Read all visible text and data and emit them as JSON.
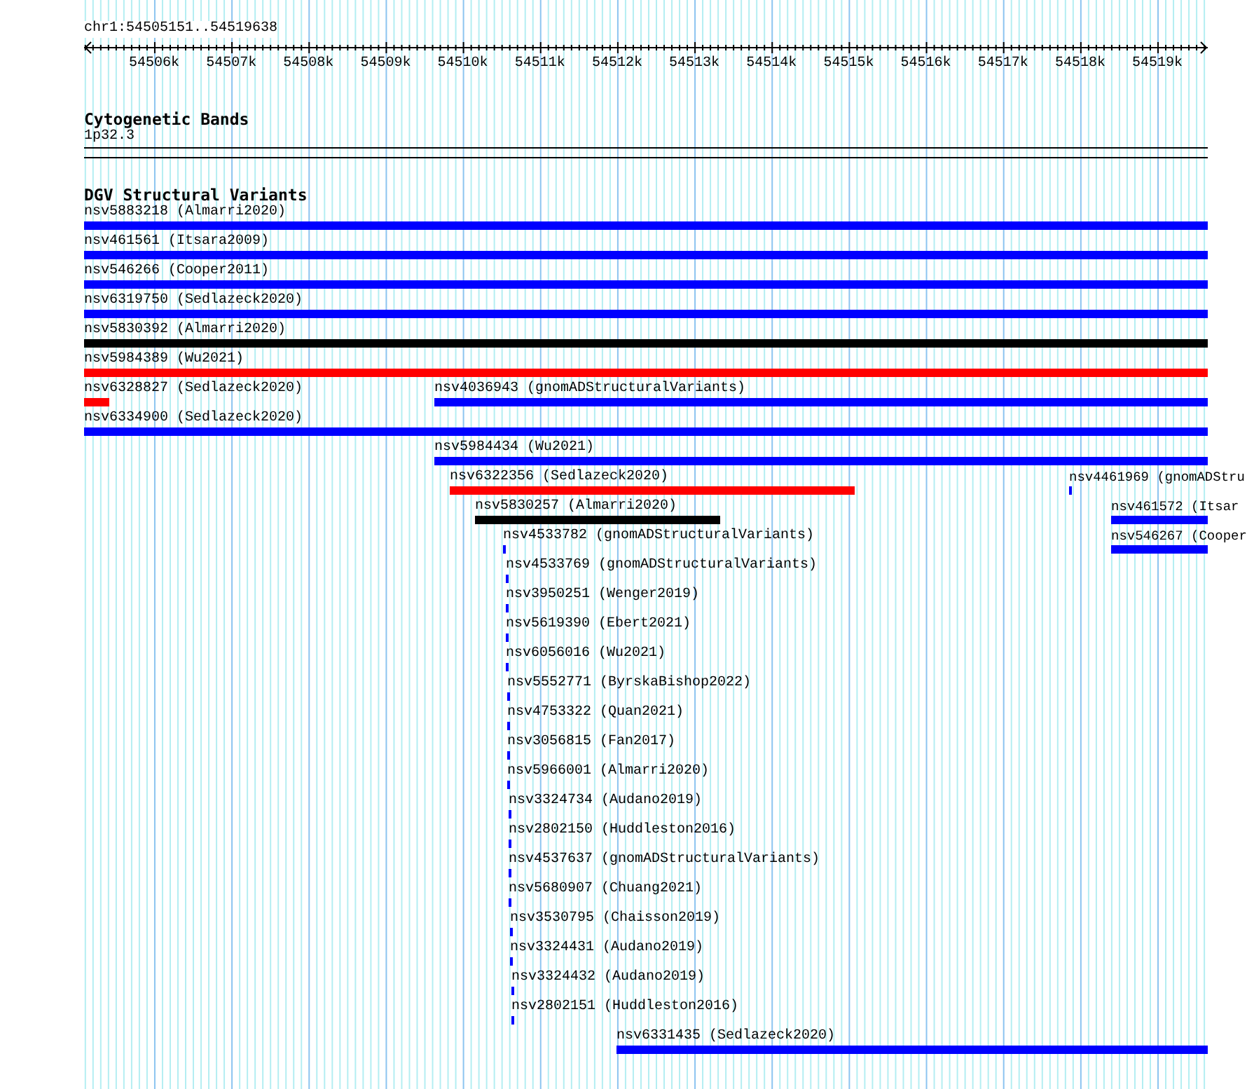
{
  "location": "chr1:54505151..54519638",
  "ruler": {
    "tick_labels": [
      "54506k",
      "54507k",
      "54508k",
      "54509k",
      "54510k",
      "54511k",
      "54512k",
      "54513k",
      "54514k",
      "54515k",
      "54516k",
      "54517k",
      "54518k",
      "54519k"
    ]
  },
  "cytogenetic_bands": {
    "title": "Cytogenetic Bands",
    "band": "1p32.3"
  },
  "dgv_track": {
    "title": "DGV Structural Variants",
    "features": [
      {
        "label": "nsv5883218 (Almarri2020)",
        "color": "#0000ff"
      },
      {
        "label": "nsv461561 (Itsara2009)",
        "color": "#0000ff"
      },
      {
        "label": "nsv546266 (Cooper2011)",
        "color": "#0000ff"
      },
      {
        "label": "nsv6319750 (Sedlazeck2020)",
        "color": "#0000ff"
      },
      {
        "label": "nsv5830392 (Almarri2020)",
        "color": "#000000"
      },
      {
        "label": "nsv5984389 (Wu2021)",
        "color": "#ff0000"
      },
      {
        "label": "nsv6328827 (Sedlazeck2020)",
        "color": "#ff0000"
      },
      {
        "label": "nsv4036943 (gnomADStructuralVariants)",
        "color": "#0000ff"
      },
      {
        "label": "nsv6334900 (Sedlazeck2020)",
        "color": "#0000ff"
      },
      {
        "label": "nsv5984434 (Wu2021)",
        "color": "#0000ff"
      },
      {
        "label": "nsv6322356 (Sedlazeck2020)",
        "color": "#ff0000"
      },
      {
        "label": "nsv4461969 (gnomADStru",
        "color": "#0000ff"
      },
      {
        "label": "nsv5830257 (Almarri2020)",
        "color": "#000000"
      },
      {
        "label": "nsv461572 (Itsar",
        "color": "#0000ff"
      },
      {
        "label": "nsv4533782 (gnomADStructuralVariants)",
        "color": "#0000ff"
      },
      {
        "label": "nsv546267 (Cooper",
        "color": "#0000ff"
      },
      {
        "label": "nsv4533769 (gnomADStructuralVariants)",
        "color": "#0000ff"
      },
      {
        "label": "nsv3950251 (Wenger2019)",
        "color": "#0000ff"
      },
      {
        "label": "nsv5619390 (Ebert2021)",
        "color": "#0000ff"
      },
      {
        "label": "nsv6056016 (Wu2021)",
        "color": "#0000ff"
      },
      {
        "label": "nsv5552771 (ByrskaBishop2022)",
        "color": "#0000ff"
      },
      {
        "label": "nsv4753322 (Quan2021)",
        "color": "#0000ff"
      },
      {
        "label": "nsv3056815 (Fan2017)",
        "color": "#0000ff"
      },
      {
        "label": "nsv5966001 (Almarri2020)",
        "color": "#0000ff"
      },
      {
        "label": "nsv3324734 (Audano2019)",
        "color": "#0000ff"
      },
      {
        "label": "nsv2802150 (Huddleston2016)",
        "color": "#0000ff"
      },
      {
        "label": "nsv4537637 (gnomADStructuralVariants)",
        "color": "#0000ff"
      },
      {
        "label": "nsv5680907 (Chuang2021)",
        "color": "#0000ff"
      },
      {
        "label": "nsv3530795 (Chaisson2019)",
        "color": "#0000ff"
      },
      {
        "label": "nsv3324431 (Audano2019)",
        "color": "#0000ff"
      },
      {
        "label": "nsv3324432 (Audano2019)",
        "color": "#0000ff"
      },
      {
        "label": "nsv2802151 (Huddleston2016)",
        "color": "#0000ff"
      },
      {
        "label": "nsv6331435 (Sedlazeck2020)",
        "color": "#0000ff"
      }
    ]
  }
}
